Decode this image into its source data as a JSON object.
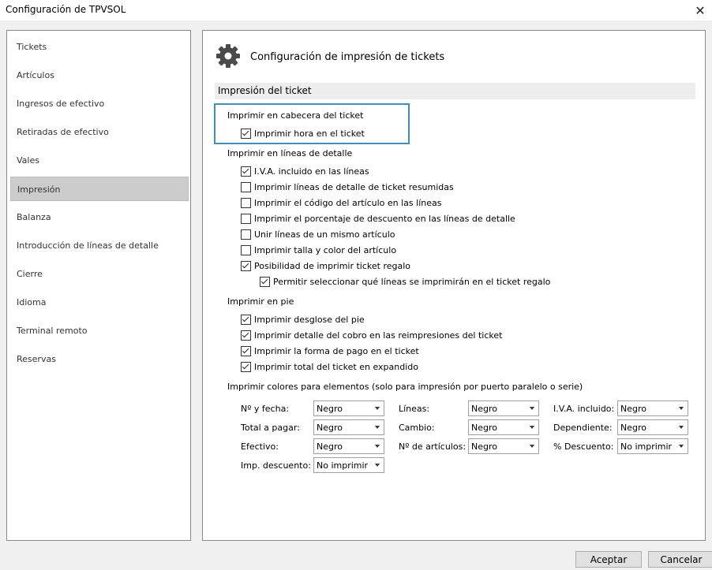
{
  "window": {
    "title": "Configuración de TPVSOL",
    "close_symbol": "✕"
  },
  "sidebar": {
    "items": [
      {
        "label": "Tickets"
      },
      {
        "label": "Artículos"
      },
      {
        "label": "Ingresos de efectivo"
      },
      {
        "label": "Retiradas de efectivo"
      },
      {
        "label": "Vales"
      },
      {
        "label": "Impresión",
        "selected": true
      },
      {
        "label": "Balanza"
      },
      {
        "label": "Introducción de líneas de detalle"
      },
      {
        "label": "Cierre"
      },
      {
        "label": "Idioma"
      },
      {
        "label": "Terminal remoto"
      },
      {
        "label": "Reservas"
      }
    ]
  },
  "main": {
    "icon": "gear-icon",
    "heading": "Configuración de impresión de tickets",
    "section_title": "Impresión del ticket",
    "header_group": {
      "title": "Imprimir en cabecera del ticket",
      "options": [
        {
          "label": "Imprimir hora en el ticket",
          "checked": true
        }
      ]
    },
    "detail_group": {
      "title": "Imprimir en líneas de detalle",
      "options": [
        {
          "label": "I.V.A. incluido en las líneas",
          "checked": true
        },
        {
          "label": "Imprimir líneas de detalle de ticket resumidas",
          "checked": false
        },
        {
          "label": "Imprimir el código del artículo en las líneas",
          "checked": false
        },
        {
          "label": "Imprimir el porcentaje de descuento en las líneas de detalle",
          "checked": false
        },
        {
          "label": "Unir líneas de un mismo artículo",
          "checked": false
        },
        {
          "label": "Imprimir talla y color del artículo",
          "checked": false
        },
        {
          "label": "Posibilidad de imprimir ticket regalo",
          "checked": true
        },
        {
          "label": "Permitir seleccionar qué líneas se imprimirán en el ticket regalo",
          "checked": true
        }
      ]
    },
    "footer_group": {
      "title": "Imprimir en pie",
      "options": [
        {
          "label": "Imprimir desglose del pie",
          "checked": true
        },
        {
          "label": "Imprimir detalle del cobro en las reimpresiones del ticket",
          "checked": true
        },
        {
          "label": "Imprimir la forma de pago en el ticket",
          "checked": true
        },
        {
          "label": "Imprimir total del ticket en expandido",
          "checked": true
        }
      ]
    },
    "colors_group": {
      "title": "Imprimir colores para elementos (solo para impresión por puerto paralelo o serie)",
      "fields": [
        {
          "label": "Nº y fecha:",
          "value": "Negro"
        },
        {
          "label": "Líneas:",
          "value": "Negro"
        },
        {
          "label": "I.V.A. incluido:",
          "value": "Negro"
        },
        {
          "label": "Total a pagar:",
          "value": "Negro"
        },
        {
          "label": "Cambio:",
          "value": "Negro"
        },
        {
          "label": "Dependiente:",
          "value": "Negro"
        },
        {
          "label": "Efectivo:",
          "value": "Negro"
        },
        {
          "label": "Nº de artículos:",
          "value": "Negro"
        },
        {
          "label": "% Descuento:",
          "value": "No imprimir"
        },
        {
          "label": "Imp. descuento:",
          "value": "No imprimir"
        }
      ]
    }
  },
  "buttons": {
    "accept": "Aceptar",
    "cancel": "Cancelar"
  },
  "colors": {
    "focus_border": "#3f8fb8",
    "selected_item": "#cccccc",
    "window_bg": "#f0f0f0"
  }
}
